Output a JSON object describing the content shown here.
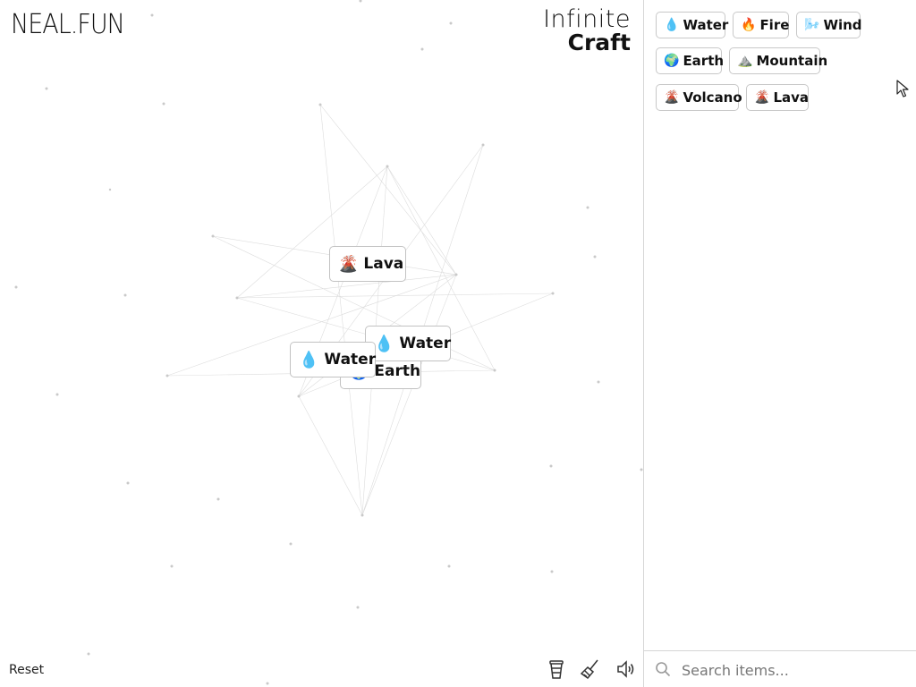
{
  "logo": "NEAL.FUN",
  "title": {
    "line1": "Infinite",
    "line2": "Craft"
  },
  "sidebar": {
    "items": [
      {
        "emoji": "💧",
        "label": "Water"
      },
      {
        "emoji": "🔥",
        "label": "Fire"
      },
      {
        "emoji": "🌬️",
        "label": "Wind"
      },
      {
        "emoji": "🌍",
        "label": "Earth"
      },
      {
        "emoji": "⛰️",
        "label": "Mountain"
      },
      {
        "emoji": "🌋",
        "label": "Volcano"
      },
      {
        "emoji": "🌋",
        "label": "Lava"
      }
    ],
    "search_placeholder": "Search items..."
  },
  "canvas": {
    "nodes": [
      {
        "emoji": "🌋",
        "label": "Lava"
      },
      {
        "emoji": "🌍",
        "label": "Earth"
      },
      {
        "emoji": "💧",
        "label": "Water"
      },
      {
        "emoji": "💧",
        "label": "Water"
      }
    ]
  },
  "footer": {
    "reset_label": "Reset",
    "icons": [
      "cup-icon",
      "broom-icon",
      "sound-icon"
    ]
  }
}
